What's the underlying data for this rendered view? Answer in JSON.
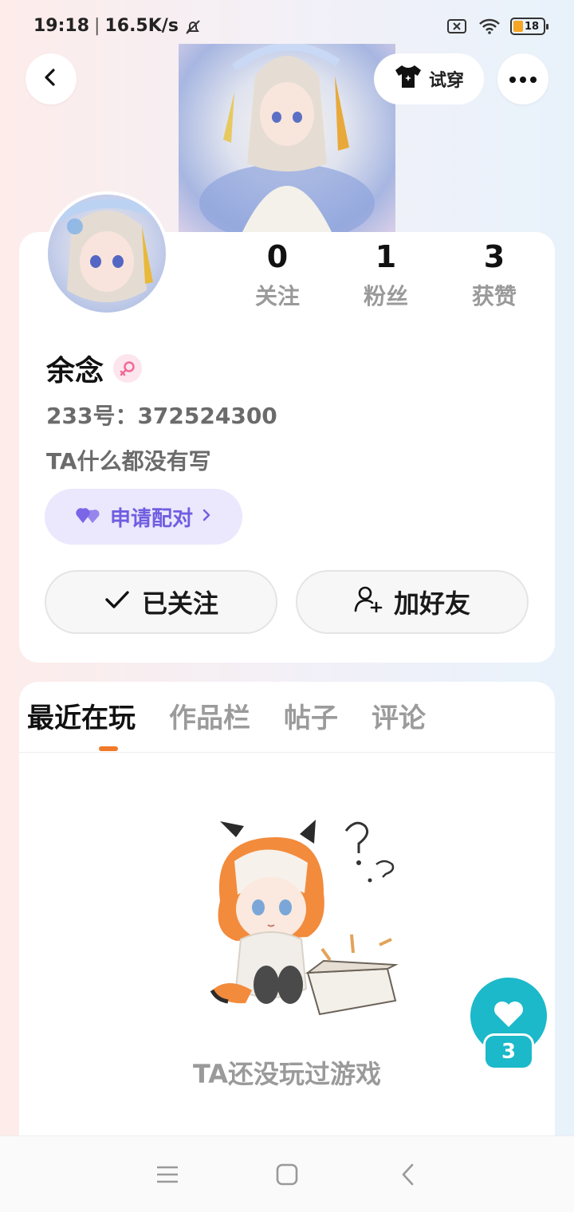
{
  "status_bar": {
    "time": "19:18",
    "network_speed": "16.5K/s",
    "battery_level": "18",
    "icons": [
      "mute-bell-icon",
      "sim-off-icon",
      "wifi-icon",
      "battery-icon"
    ]
  },
  "header": {
    "try_on_label": "试穿",
    "icons": [
      "back-icon",
      "tshirt-icon",
      "more-icon"
    ]
  },
  "profile": {
    "stats": [
      {
        "value": "0",
        "label": "关注"
      },
      {
        "value": "1",
        "label": "粉丝"
      },
      {
        "value": "3",
        "label": "获赞"
      }
    ],
    "name": "余念",
    "gender_icon": "female-icon",
    "uid_text": "233号：372524300",
    "bio": "TA什么都没有写",
    "pair_button": "申请配对",
    "follow_button": "已关注",
    "add_friend_button": "加好友"
  },
  "tabs": [
    "最近在玩",
    "作品栏",
    "帖子",
    "评论"
  ],
  "active_tab": 0,
  "empty_state": {
    "text": "TA还没玩过游戏"
  },
  "like_fab": {
    "count": "3"
  },
  "colors": {
    "accent_orange": "#f07a2a",
    "pair_purple": "#6f5ee0",
    "like_teal": "#1bb9c9"
  }
}
